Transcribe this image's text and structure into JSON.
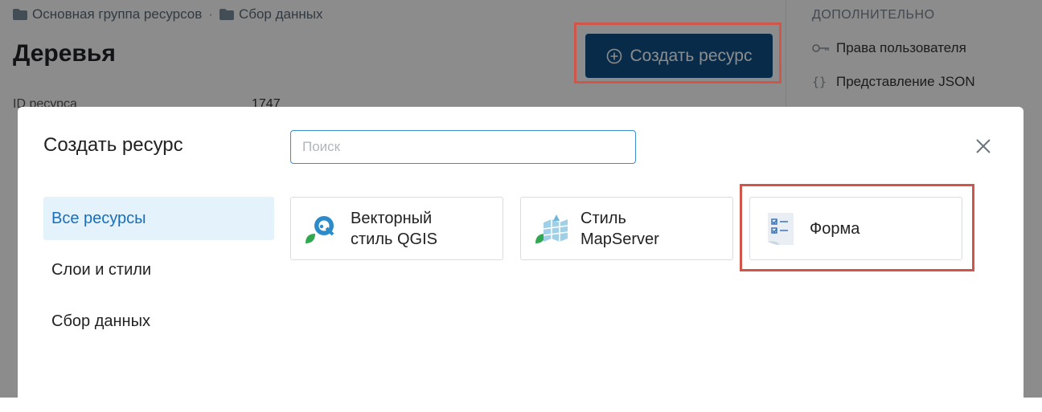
{
  "breadcrumb": [
    {
      "label": "Основная группа ресурсов"
    },
    {
      "label": "Сбор данных"
    }
  ],
  "breadcrumb_separator": "·",
  "page": {
    "title": "Деревья",
    "create_button": "Создать ресурс",
    "info": [
      {
        "label": "ID ресурса",
        "value": "1747"
      }
    ]
  },
  "sidebar": {
    "heading": "ДОПОЛНИТЕЛЬНО",
    "links": [
      {
        "label": "Права пользователя",
        "icon": "key-icon"
      },
      {
        "label": "Представление JSON",
        "icon": "braces-icon"
      }
    ]
  },
  "modal": {
    "title": "Создать ресурс",
    "search_placeholder": "Поиск",
    "search_value": "",
    "categories": [
      {
        "label": "Все ресурсы",
        "active": true
      },
      {
        "label": "Слои и стили",
        "active": false
      },
      {
        "label": "Сбор данных",
        "active": false
      }
    ],
    "cards": [
      {
        "label": "Векторный\nстиль QGIS",
        "icon": "qgis-style-icon"
      },
      {
        "label": "Стиль\nMapServer",
        "icon": "mapserver-style-icon"
      },
      {
        "label": "Форма",
        "icon": "form-icon"
      }
    ]
  },
  "colors": {
    "primary": "#0e4f86",
    "highlight": "#d0564a",
    "active_bg": "#e3f2fb",
    "active_text": "#1a6fb8",
    "focus_border": "#3b8ed6"
  }
}
